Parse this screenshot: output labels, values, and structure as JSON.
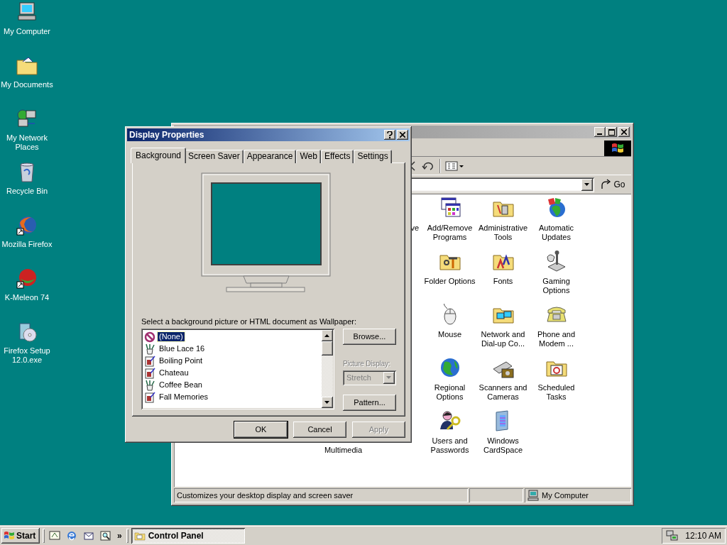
{
  "desktop_icons": [
    {
      "label": "My Computer"
    },
    {
      "label": "My Documents"
    },
    {
      "label": "My Network Places"
    },
    {
      "label": "Recycle Bin"
    },
    {
      "label": "Mozilla Firefox"
    },
    {
      "label": "K-Meleon 74"
    },
    {
      "label": "Firefox Setup 12.0.exe"
    }
  ],
  "control_panel": {
    "go": "Go",
    "grid_rows": [
      [
        null,
        {
          "label": "ve",
          "kind": "cut-right"
        },
        {
          "label": "Add/Remove Programs",
          "kind": "icon"
        },
        {
          "label": "Administrative Tools",
          "kind": "icon"
        },
        {
          "label": "Automatic Updates",
          "kind": "icon"
        }
      ],
      [
        null,
        null,
        {
          "label": "Folder Options",
          "kind": "icon"
        },
        {
          "label": "Fonts",
          "kind": "icon"
        },
        {
          "label": "Gaming Options",
          "kind": "icon"
        }
      ],
      [
        null,
        null,
        {
          "label": "Mouse",
          "kind": "icon"
        },
        {
          "label": "Network and Dial-up Co...",
          "kind": "icon"
        },
        {
          "label": "Phone and Modem ...",
          "kind": "icon"
        }
      ],
      [
        null,
        null,
        {
          "label": "Regional Options",
          "kind": "icon"
        },
        {
          "label": "Scanners and Cameras",
          "kind": "icon"
        },
        {
          "label": "Scheduled Tasks",
          "kind": "icon"
        }
      ],
      [
        {
          "label": "Multimedia",
          "kind": "cut-top"
        },
        null,
        {
          "label": "Users and Passwords",
          "kind": "icon"
        },
        {
          "label": "Windows CardSpace",
          "kind": "icon"
        },
        null
      ]
    ],
    "status_bar": {
      "text": "Customizes your desktop display and screen saver",
      "zone": "My Computer"
    }
  },
  "dialog": {
    "title": "Display Properties",
    "tabs": [
      {
        "label": "Background",
        "selected": true
      },
      {
        "label": "Screen Saver",
        "selected": false
      },
      {
        "label": "Appearance",
        "selected": false
      },
      {
        "label": "Web",
        "selected": false
      },
      {
        "label": "Effects",
        "selected": false
      },
      {
        "label": "Settings",
        "selected": false
      }
    ],
    "wallpaper_label": "Select a background picture or HTML document as Wallpaper:",
    "wallpapers": [
      {
        "label": "(None)",
        "kind": "none",
        "selected": true
      },
      {
        "label": "Blue Lace 16",
        "kind": "bitmap",
        "selected": false
      },
      {
        "label": "Boiling Point",
        "kind": "html",
        "selected": false
      },
      {
        "label": "Chateau",
        "kind": "html",
        "selected": false
      },
      {
        "label": "Coffee Bean",
        "kind": "bitmap",
        "selected": false
      },
      {
        "label": "Fall Memories",
        "kind": "html",
        "selected": false
      }
    ],
    "browse": "Browse...",
    "picture_display": {
      "label": "Picture Display:",
      "value": "Stretch",
      "disabled": true
    },
    "pattern": "Pattern...",
    "buttons": [
      {
        "label": "OK",
        "disabled": false
      },
      {
        "label": "Cancel",
        "disabled": false
      },
      {
        "label": "Apply",
        "disabled": true
      }
    ]
  },
  "taskbar": {
    "start": "Start",
    "more": "»",
    "tasks": [
      {
        "label": "Control Panel",
        "selected": true
      }
    ],
    "clock": "12:10 AM"
  }
}
